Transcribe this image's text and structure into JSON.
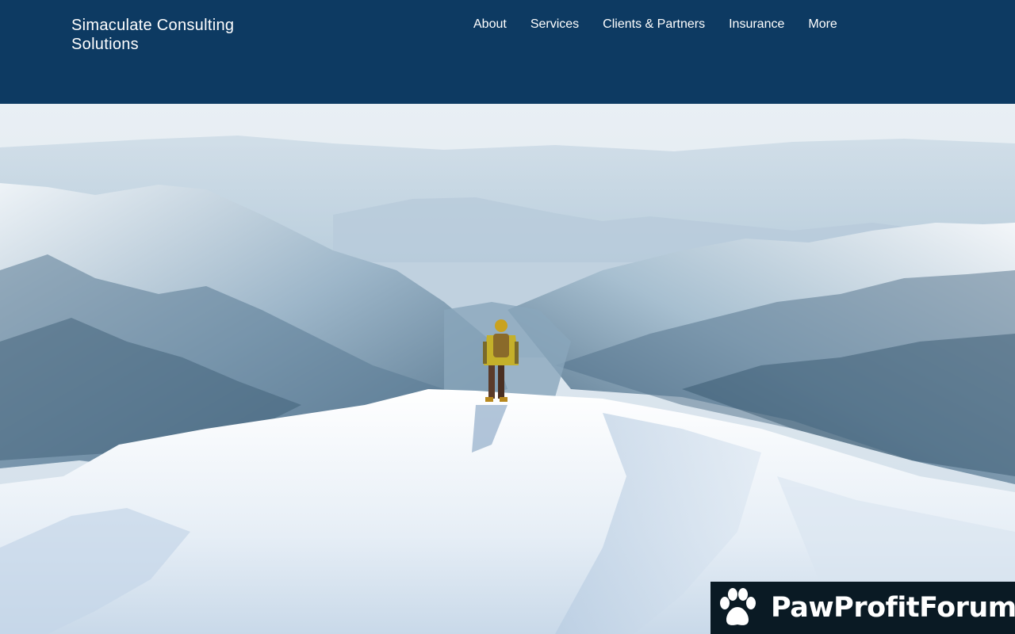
{
  "header": {
    "site_title": "Simaculate Consulting Solutions",
    "nav": [
      {
        "label": "About"
      },
      {
        "label": "Services"
      },
      {
        "label": "Clients & Partners"
      },
      {
        "label": "Insurance"
      },
      {
        "label": "More"
      }
    ]
  },
  "hero": {
    "image_icon": "mountain-hiker-image"
  },
  "badge": {
    "name": "PawProfitForum",
    "icon": "paw-icon"
  },
  "colors": {
    "header_bg": "#0d3a62",
    "badge_bg": "#0a1a24",
    "text": "#ffffff"
  }
}
